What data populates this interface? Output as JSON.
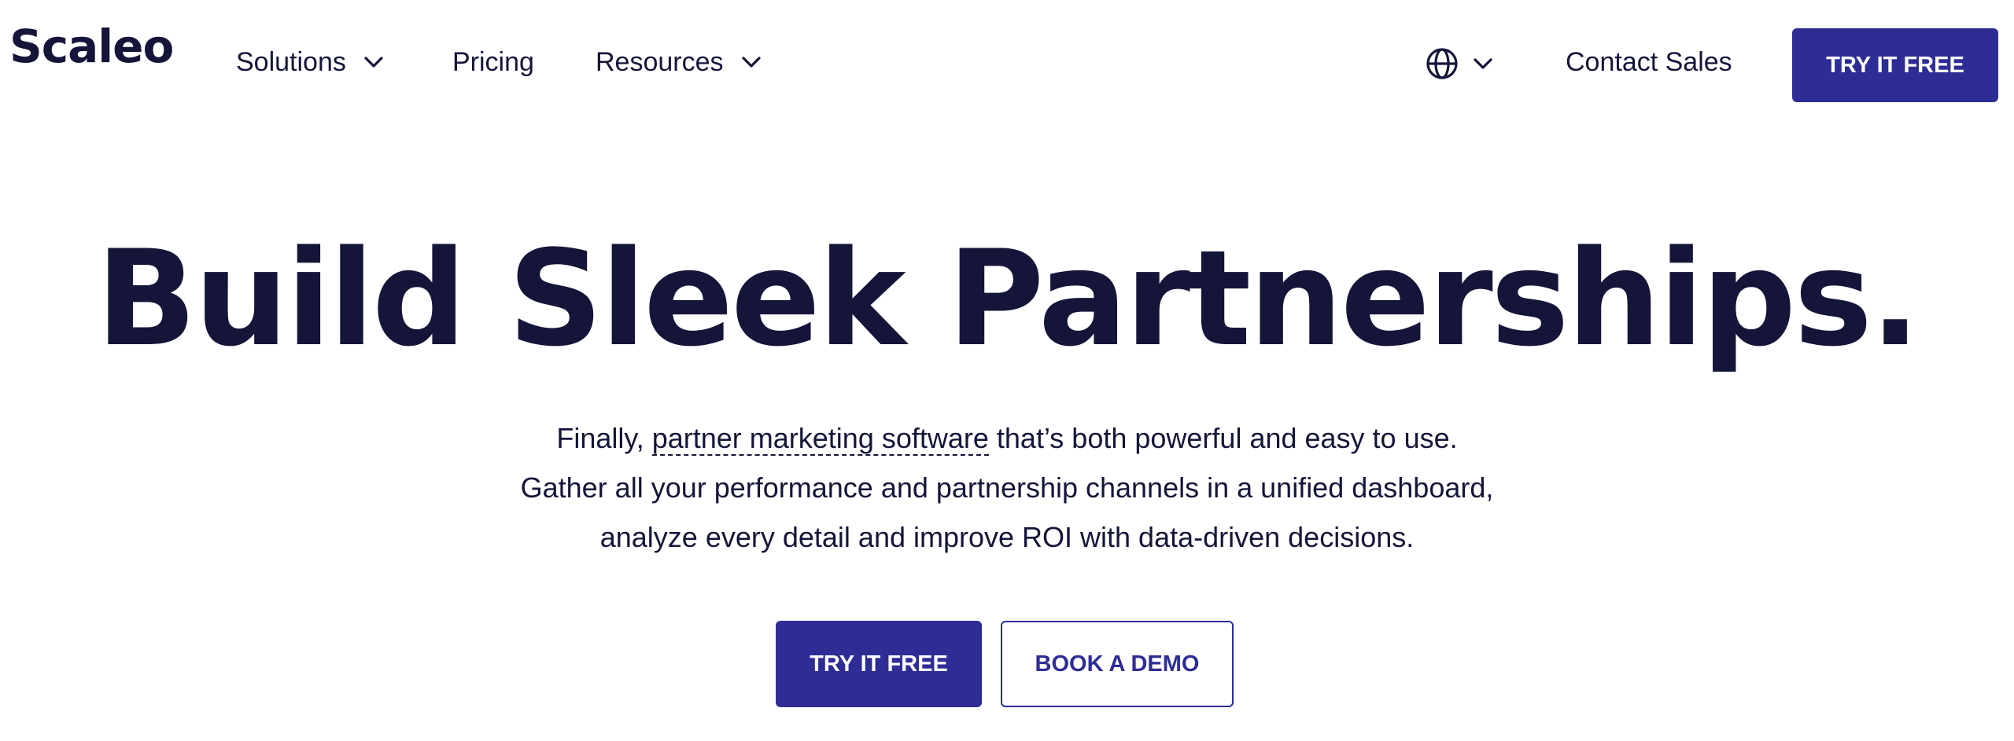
{
  "header": {
    "logo": "Scaleo",
    "nav": {
      "solutions": "Solutions",
      "pricing": "Pricing",
      "resources": "Resources"
    },
    "language_icon": "globe-icon",
    "contact_sales": "Contact Sales",
    "cta": "TRY IT FREE"
  },
  "hero": {
    "title": "Build Sleek Partnerships.",
    "subtitle": {
      "line1_prefix": "Finally, ",
      "line1_link": "partner marketing software",
      "line1_suffix": " that’s both powerful and easy to use.",
      "line2": "Gather all your performance and partnership channels in a unified dashboard,",
      "line3": "analyze every detail and improve ROI with data-driven decisions."
    },
    "cta_primary": "TRY IT FREE",
    "cta_secondary": "BOOK A DEMO"
  },
  "colors": {
    "brand": "#2e2d96",
    "text": "#15153a",
    "background": "#ffffff"
  }
}
